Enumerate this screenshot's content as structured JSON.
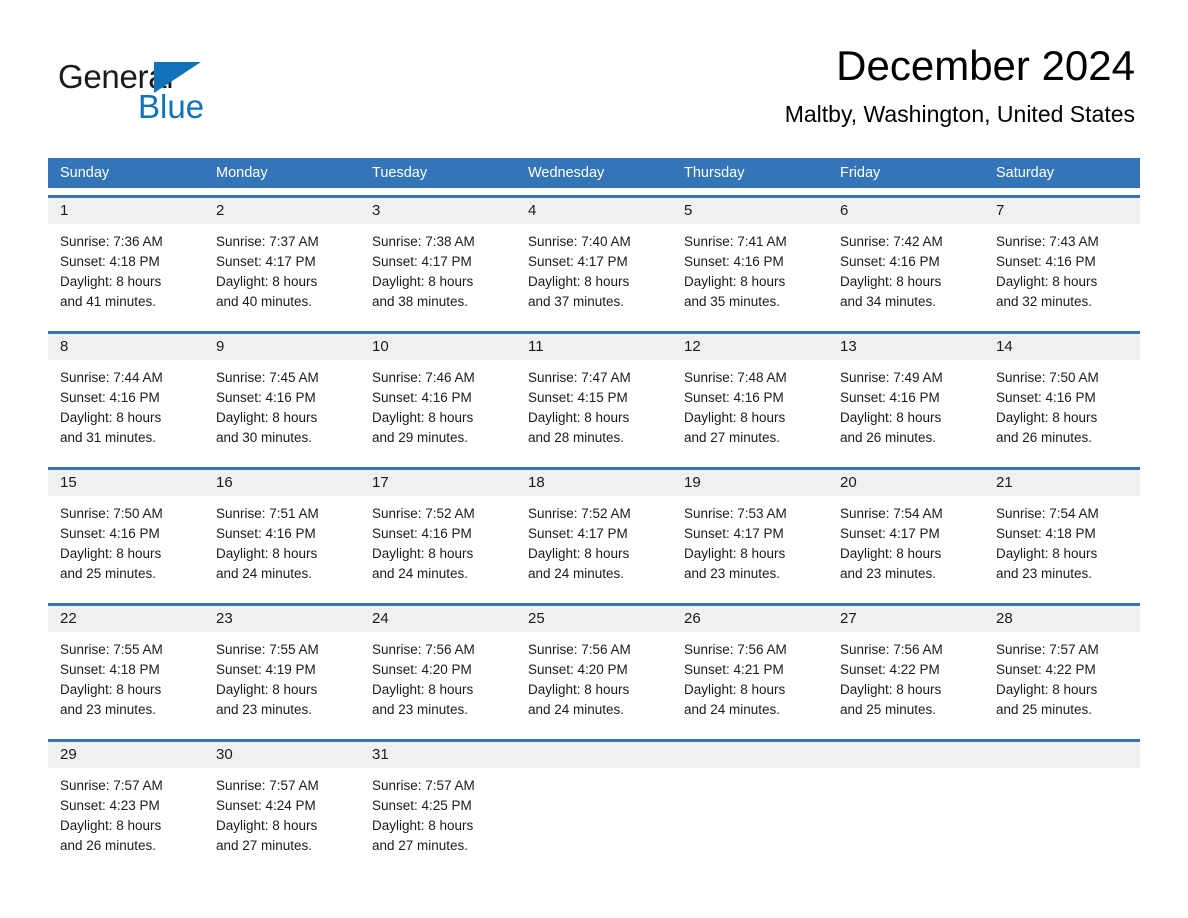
{
  "brand": {
    "name_part1": "General",
    "name_part2": "Blue",
    "accent_color": "#1073b8"
  },
  "header": {
    "title": "December 2024",
    "subtitle": "Maltby, Washington, United States"
  },
  "calendar": {
    "header_color": "#3375b6",
    "weekdays": [
      "Sunday",
      "Monday",
      "Tuesday",
      "Wednesday",
      "Thursday",
      "Friday",
      "Saturday"
    ],
    "weeks": [
      [
        {
          "day": "1",
          "sunrise": "Sunrise: 7:36 AM",
          "sunset": "Sunset: 4:18 PM",
          "daylight_line1": "Daylight: 8 hours",
          "daylight_line2": "and 41 minutes."
        },
        {
          "day": "2",
          "sunrise": "Sunrise: 7:37 AM",
          "sunset": "Sunset: 4:17 PM",
          "daylight_line1": "Daylight: 8 hours",
          "daylight_line2": "and 40 minutes."
        },
        {
          "day": "3",
          "sunrise": "Sunrise: 7:38 AM",
          "sunset": "Sunset: 4:17 PM",
          "daylight_line1": "Daylight: 8 hours",
          "daylight_line2": "and 38 minutes."
        },
        {
          "day": "4",
          "sunrise": "Sunrise: 7:40 AM",
          "sunset": "Sunset: 4:17 PM",
          "daylight_line1": "Daylight: 8 hours",
          "daylight_line2": "and 37 minutes."
        },
        {
          "day": "5",
          "sunrise": "Sunrise: 7:41 AM",
          "sunset": "Sunset: 4:16 PM",
          "daylight_line1": "Daylight: 8 hours",
          "daylight_line2": "and 35 minutes."
        },
        {
          "day": "6",
          "sunrise": "Sunrise: 7:42 AM",
          "sunset": "Sunset: 4:16 PM",
          "daylight_line1": "Daylight: 8 hours",
          "daylight_line2": "and 34 minutes."
        },
        {
          "day": "7",
          "sunrise": "Sunrise: 7:43 AM",
          "sunset": "Sunset: 4:16 PM",
          "daylight_line1": "Daylight: 8 hours",
          "daylight_line2": "and 32 minutes."
        }
      ],
      [
        {
          "day": "8",
          "sunrise": "Sunrise: 7:44 AM",
          "sunset": "Sunset: 4:16 PM",
          "daylight_line1": "Daylight: 8 hours",
          "daylight_line2": "and 31 minutes."
        },
        {
          "day": "9",
          "sunrise": "Sunrise: 7:45 AM",
          "sunset": "Sunset: 4:16 PM",
          "daylight_line1": "Daylight: 8 hours",
          "daylight_line2": "and 30 minutes."
        },
        {
          "day": "10",
          "sunrise": "Sunrise: 7:46 AM",
          "sunset": "Sunset: 4:16 PM",
          "daylight_line1": "Daylight: 8 hours",
          "daylight_line2": "and 29 minutes."
        },
        {
          "day": "11",
          "sunrise": "Sunrise: 7:47 AM",
          "sunset": "Sunset: 4:15 PM",
          "daylight_line1": "Daylight: 8 hours",
          "daylight_line2": "and 28 minutes."
        },
        {
          "day": "12",
          "sunrise": "Sunrise: 7:48 AM",
          "sunset": "Sunset: 4:16 PM",
          "daylight_line1": "Daylight: 8 hours",
          "daylight_line2": "and 27 minutes."
        },
        {
          "day": "13",
          "sunrise": "Sunrise: 7:49 AM",
          "sunset": "Sunset: 4:16 PM",
          "daylight_line1": "Daylight: 8 hours",
          "daylight_line2": "and 26 minutes."
        },
        {
          "day": "14",
          "sunrise": "Sunrise: 7:50 AM",
          "sunset": "Sunset: 4:16 PM",
          "daylight_line1": "Daylight: 8 hours",
          "daylight_line2": "and 26 minutes."
        }
      ],
      [
        {
          "day": "15",
          "sunrise": "Sunrise: 7:50 AM",
          "sunset": "Sunset: 4:16 PM",
          "daylight_line1": "Daylight: 8 hours",
          "daylight_line2": "and 25 minutes."
        },
        {
          "day": "16",
          "sunrise": "Sunrise: 7:51 AM",
          "sunset": "Sunset: 4:16 PM",
          "daylight_line1": "Daylight: 8 hours",
          "daylight_line2": "and 24 minutes."
        },
        {
          "day": "17",
          "sunrise": "Sunrise: 7:52 AM",
          "sunset": "Sunset: 4:16 PM",
          "daylight_line1": "Daylight: 8 hours",
          "daylight_line2": "and 24 minutes."
        },
        {
          "day": "18",
          "sunrise": "Sunrise: 7:52 AM",
          "sunset": "Sunset: 4:17 PM",
          "daylight_line1": "Daylight: 8 hours",
          "daylight_line2": "and 24 minutes."
        },
        {
          "day": "19",
          "sunrise": "Sunrise: 7:53 AM",
          "sunset": "Sunset: 4:17 PM",
          "daylight_line1": "Daylight: 8 hours",
          "daylight_line2": "and 23 minutes."
        },
        {
          "day": "20",
          "sunrise": "Sunrise: 7:54 AM",
          "sunset": "Sunset: 4:17 PM",
          "daylight_line1": "Daylight: 8 hours",
          "daylight_line2": "and 23 minutes."
        },
        {
          "day": "21",
          "sunrise": "Sunrise: 7:54 AM",
          "sunset": "Sunset: 4:18 PM",
          "daylight_line1": "Daylight: 8 hours",
          "daylight_line2": "and 23 minutes."
        }
      ],
      [
        {
          "day": "22",
          "sunrise": "Sunrise: 7:55 AM",
          "sunset": "Sunset: 4:18 PM",
          "daylight_line1": "Daylight: 8 hours",
          "daylight_line2": "and 23 minutes."
        },
        {
          "day": "23",
          "sunrise": "Sunrise: 7:55 AM",
          "sunset": "Sunset: 4:19 PM",
          "daylight_line1": "Daylight: 8 hours",
          "daylight_line2": "and 23 minutes."
        },
        {
          "day": "24",
          "sunrise": "Sunrise: 7:56 AM",
          "sunset": "Sunset: 4:20 PM",
          "daylight_line1": "Daylight: 8 hours",
          "daylight_line2": "and 23 minutes."
        },
        {
          "day": "25",
          "sunrise": "Sunrise: 7:56 AM",
          "sunset": "Sunset: 4:20 PM",
          "daylight_line1": "Daylight: 8 hours",
          "daylight_line2": "and 24 minutes."
        },
        {
          "day": "26",
          "sunrise": "Sunrise: 7:56 AM",
          "sunset": "Sunset: 4:21 PM",
          "daylight_line1": "Daylight: 8 hours",
          "daylight_line2": "and 24 minutes."
        },
        {
          "day": "27",
          "sunrise": "Sunrise: 7:56 AM",
          "sunset": "Sunset: 4:22 PM",
          "daylight_line1": "Daylight: 8 hours",
          "daylight_line2": "and 25 minutes."
        },
        {
          "day": "28",
          "sunrise": "Sunrise: 7:57 AM",
          "sunset": "Sunset: 4:22 PM",
          "daylight_line1": "Daylight: 8 hours",
          "daylight_line2": "and 25 minutes."
        }
      ],
      [
        {
          "day": "29",
          "sunrise": "Sunrise: 7:57 AM",
          "sunset": "Sunset: 4:23 PM",
          "daylight_line1": "Daylight: 8 hours",
          "daylight_line2": "and 26 minutes."
        },
        {
          "day": "30",
          "sunrise": "Sunrise: 7:57 AM",
          "sunset": "Sunset: 4:24 PM",
          "daylight_line1": "Daylight: 8 hours",
          "daylight_line2": "and 27 minutes."
        },
        {
          "day": "31",
          "sunrise": "Sunrise: 7:57 AM",
          "sunset": "Sunset: 4:25 PM",
          "daylight_line1": "Daylight: 8 hours",
          "daylight_line2": "and 27 minutes."
        },
        {
          "day": "",
          "sunrise": "",
          "sunset": "",
          "daylight_line1": "",
          "daylight_line2": ""
        },
        {
          "day": "",
          "sunrise": "",
          "sunset": "",
          "daylight_line1": "",
          "daylight_line2": ""
        },
        {
          "day": "",
          "sunrise": "",
          "sunset": "",
          "daylight_line1": "",
          "daylight_line2": ""
        },
        {
          "day": "",
          "sunrise": "",
          "sunset": "",
          "daylight_line1": "",
          "daylight_line2": ""
        }
      ]
    ]
  }
}
